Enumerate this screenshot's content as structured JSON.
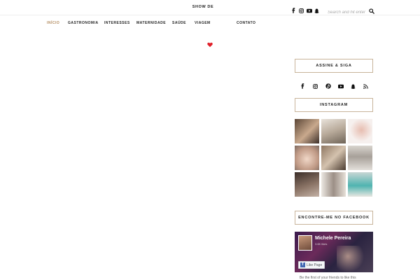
{
  "header": {
    "site_title": "SHOW DE",
    "search_placeholder": "Search and hit enter",
    "social_icons": [
      "facebook-icon",
      "instagram-icon",
      "youtube-icon",
      "snapchat-icon"
    ]
  },
  "nav": {
    "items": [
      {
        "label": "INÍCIO",
        "active": true
      },
      {
        "label": "GASTRONOMIA",
        "active": false
      },
      {
        "label": "INTERESSES",
        "active": false
      },
      {
        "label": "MATERNIDADE",
        "active": false
      },
      {
        "label": "SAÚDE",
        "active": false
      },
      {
        "label": "VIAGEM",
        "active": false
      },
      {
        "label": "CONTATO",
        "active": false
      }
    ],
    "active_color": "#b28b5e"
  },
  "sidebar": {
    "follow_title": "ASSINE & SIGA",
    "follow_icons": [
      "facebook-icon",
      "instagram-icon",
      "pinterest-icon",
      "youtube-icon",
      "snapchat-icon",
      "rss-icon"
    ],
    "instagram_title": "INSTAGRAM",
    "instagram_photos": 9,
    "facebook_title": "ENCONTRE-ME NO FACEBOOK",
    "facebook": {
      "page_name": "Michele Pereira",
      "page_sub": "3.6K likes",
      "like_button": "Like Page",
      "caption": "Be the first of your friends to like this"
    }
  },
  "colors": {
    "accent": "#b28b5e",
    "box_border": "#c8b49a",
    "heart": "#e0202a"
  }
}
